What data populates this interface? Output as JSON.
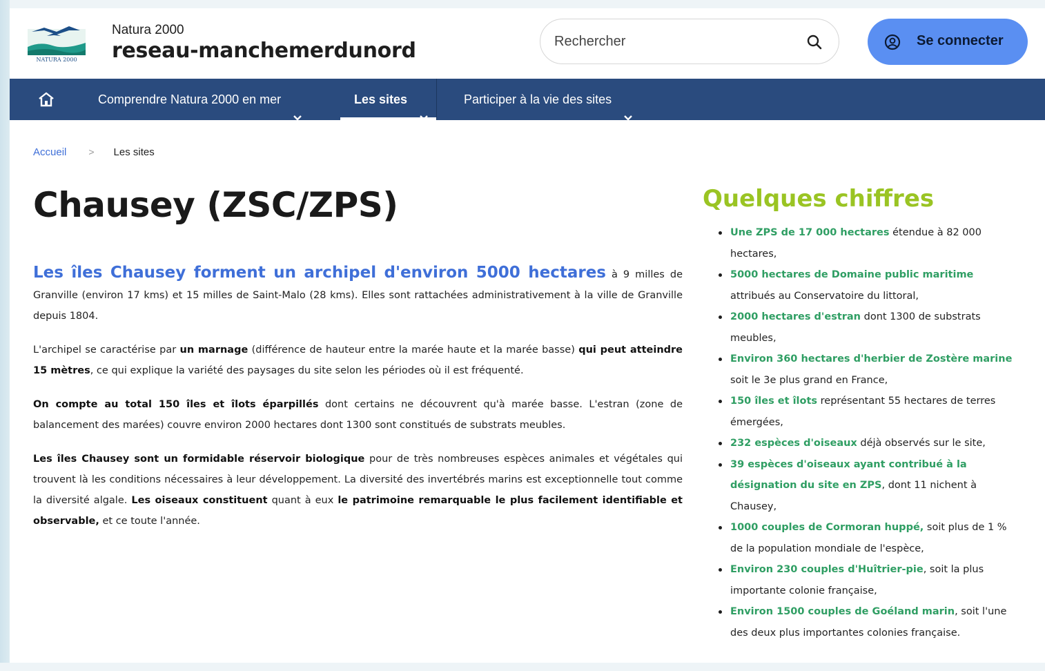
{
  "header": {
    "site_tag": "Natura 2000",
    "site_name": "reseau-manchemerdunord",
    "logo_text": "NATURA 2000",
    "search": {
      "placeholder": "Rechercher"
    },
    "login_label": "Se connecter"
  },
  "nav": {
    "items": [
      {
        "label": "Comprendre Natura 2000 en mer"
      },
      {
        "label": "Les sites",
        "active": true
      },
      {
        "label": "Participer à la vie des sites"
      }
    ]
  },
  "breadcrumb": {
    "home": "Accueil",
    "separator": ">",
    "current": "Les sites"
  },
  "page": {
    "title": "Chausey (ZSC/ZPS)",
    "paragraphs": {
      "p1_lead": "Les îles Chausey forment un archipel d'environ 5000 hectares",
      "p1_rest": " à 9 milles de Granville (environ 17 kms) et 15 milles de Saint-Malo (28 kms). Elles sont rattachées administrativement à la ville de Granville depuis 1804.",
      "p2_a": "L'archipel se caractérise par ",
      "p2_b": "un marnage",
      "p2_c": " (différence de hauteur entre la marée haute et la marée basse) ",
      "p2_d": "qui peut atteindre 15 mètres",
      "p2_e": ", ce qui explique la variété des paysages du site selon les périodes où il est fréquenté.",
      "p3_a": "On compte au total 150 îles et îlots éparpillés",
      "p3_b": " dont certains ne découvrent qu'à marée basse. L'estran (zone de balancement des marées) couvre environ 2000 hectares dont 1300 sont constitués de substrats meubles.",
      "p4_a": "Les îles Chausey sont un formidable réservoir biologique",
      "p4_b": " pour de très nombreuses espèces animales et végétales qui trouvent là les conditions nécessaires à leur développement. La diversité des invertébrés marins est exceptionnelle  tout comme la diversité algale. ",
      "p4_c": "Les oiseaux constituent",
      "p4_d": " quant à eux ",
      "p4_e": "le patrimoine remarquable le plus facilement identifiable et observable,",
      "p4_f": " et ce toute l'année."
    }
  },
  "aside": {
    "title": "Quelques chiffres",
    "items": [
      {
        "hl": "Une ZPS de 17 000 hectares",
        "text": " étendue à 82 000 hectares,"
      },
      {
        "hl": "5000 hectares de Domaine public maritime",
        "text": " attribués au Conservatoire du littoral,"
      },
      {
        "hl": "2000 hectares d'estran",
        "text": " dont 1300 de substrats meubles,"
      },
      {
        "hl": "Environ 360 hectares d'herbier de Zostère marine",
        "text": " soit le 3e plus grand en France,"
      },
      {
        "hl": "150 îles et îlots",
        "text": " représentant 55 hectares de terres émergées,"
      },
      {
        "hl": "232 espèces d'oiseaux",
        "text": " déjà observés sur le site,"
      },
      {
        "hl": "39 espèces d'oiseaux ayant contribué à la désignation du site en ZPS",
        "text": ", dont 11 nichent à Chausey,"
      },
      {
        "hl": "1000 couples de Cormoran huppé,",
        "text": " soit plus de 1 % de la population mondiale de l'espèce,"
      },
      {
        "hl": "Environ 230 couples d'Huîtrier-pie",
        "text": ", soit la plus importante colonie française,"
      },
      {
        "hl": "Environ 1500 couples de Goéland marin",
        "text": ", soit l'une des deux plus importantes colonies française."
      }
    ]
  },
  "colors": {
    "nav_bg": "#2a4b7e",
    "login_bg": "#5a8ff2",
    "link_blue": "#3f6fd8",
    "aside_title_green": "#9ac423",
    "highlight_green": "#2f9e63"
  }
}
